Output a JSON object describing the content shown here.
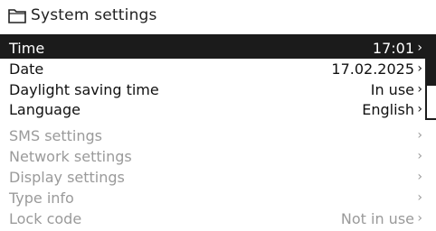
{
  "header": {
    "title": "System settings",
    "icon": "folder-icon"
  },
  "items": [
    {
      "label": "Time",
      "value": "17:01",
      "chevron": "›",
      "state": "selected"
    },
    {
      "label": "Date",
      "value": "17.02.2025",
      "chevron": "›",
      "state": "boxed"
    },
    {
      "label": "Daylight saving time",
      "value": "In use",
      "chevron": "›",
      "state": "boxed"
    },
    {
      "label": "Language",
      "value": "English",
      "chevron": "›",
      "state": "boxed"
    },
    {
      "label": "SMS settings",
      "value": "",
      "chevron": "›",
      "state": "dim"
    },
    {
      "label": "Network settings",
      "value": "",
      "chevron": "›",
      "state": "dim"
    },
    {
      "label": "Display settings",
      "value": "",
      "chevron": "›",
      "state": "dim"
    },
    {
      "label": "Type info",
      "value": "",
      "chevron": "›",
      "state": "dim"
    },
    {
      "label": "Lock code",
      "value": "Not in use",
      "chevron": "›",
      "state": "dim"
    }
  ],
  "colors": {
    "panel": "#1b1b1b",
    "dim_text": "#9a9a9a",
    "background": "#ffffff"
  }
}
